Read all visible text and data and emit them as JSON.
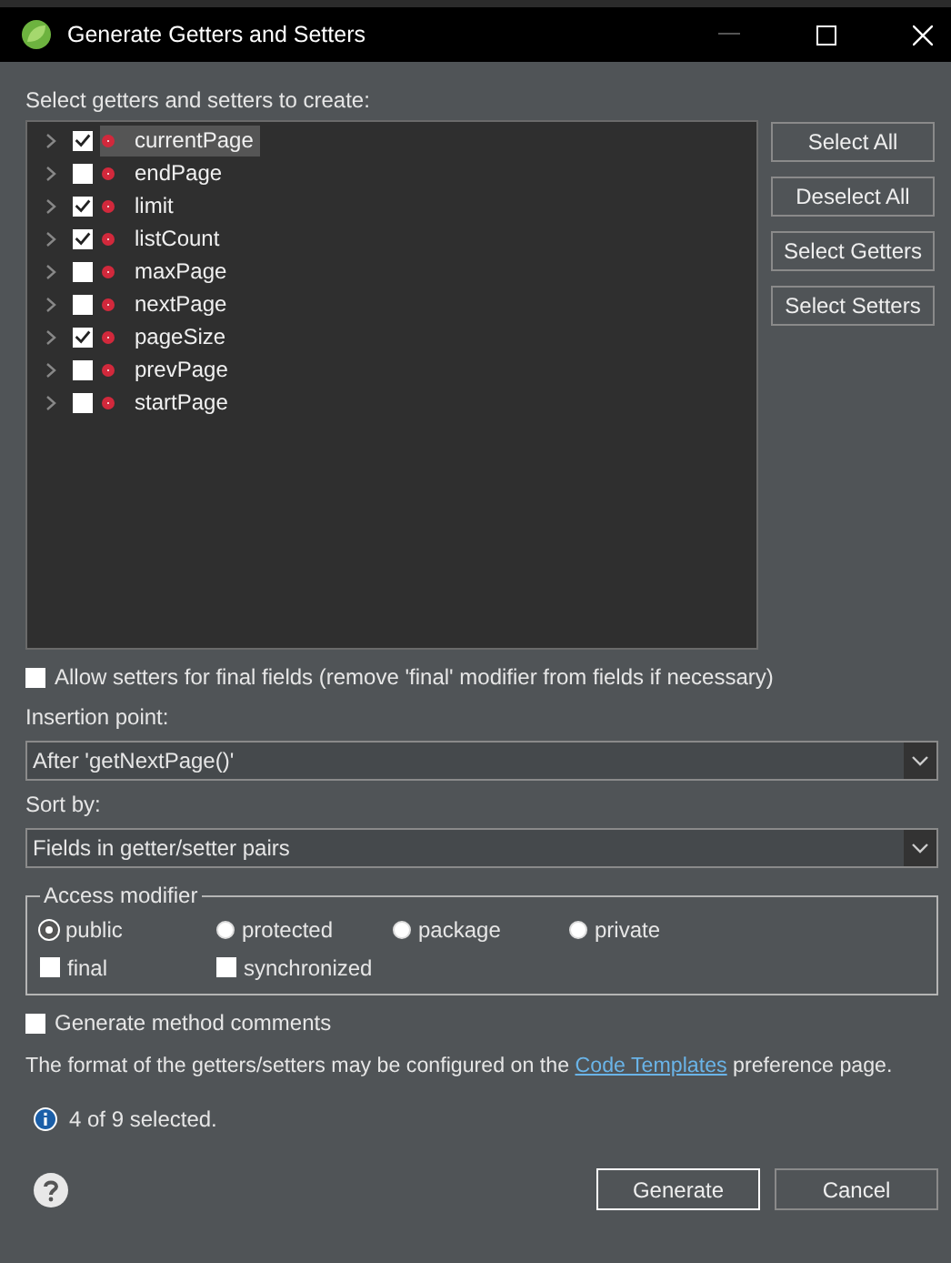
{
  "window": {
    "title": "Generate Getters and Setters"
  },
  "fields_label": "Select getters and setters to create:",
  "fields": [
    {
      "name": "currentPage",
      "checked": true,
      "selected": true
    },
    {
      "name": "endPage",
      "checked": false,
      "selected": false
    },
    {
      "name": "limit",
      "checked": true,
      "selected": false
    },
    {
      "name": "listCount",
      "checked": true,
      "selected": false
    },
    {
      "name": "maxPage",
      "checked": false,
      "selected": false
    },
    {
      "name": "nextPage",
      "checked": false,
      "selected": false
    },
    {
      "name": "pageSize",
      "checked": true,
      "selected": false
    },
    {
      "name": "prevPage",
      "checked": false,
      "selected": false
    },
    {
      "name": "startPage",
      "checked": false,
      "selected": false
    }
  ],
  "side_buttons": [
    "Select All",
    "Deselect All",
    "Select Getters",
    "Select Setters"
  ],
  "allow_final": {
    "label": "Allow setters for final fields (remove 'final' modifier from fields if necessary)",
    "checked": false
  },
  "insertion_point": {
    "label": "Insertion point:",
    "value": "After 'getNextPage()'"
  },
  "sort_by": {
    "label": "Sort by:",
    "value": "Fields in getter/setter pairs"
  },
  "access_modifier": {
    "title": "Access modifier",
    "options": [
      {
        "label": "public",
        "selected": true
      },
      {
        "label": "protected",
        "selected": false
      },
      {
        "label": "package",
        "selected": false
      },
      {
        "label": "private",
        "selected": false
      }
    ],
    "modifiers": [
      {
        "label": "final",
        "checked": false
      },
      {
        "label": "synchronized",
        "checked": false
      }
    ]
  },
  "generate_comments": {
    "label": "Generate method comments",
    "checked": false
  },
  "note": {
    "before": "The format of the getters/setters may be configured on the",
    "link": "Code Templates",
    "after": "preference page."
  },
  "status": "4 of 9 selected.",
  "buttons": [
    {
      "label": "Generate",
      "default": true
    },
    {
      "label": "Cancel",
      "default": false
    }
  ]
}
